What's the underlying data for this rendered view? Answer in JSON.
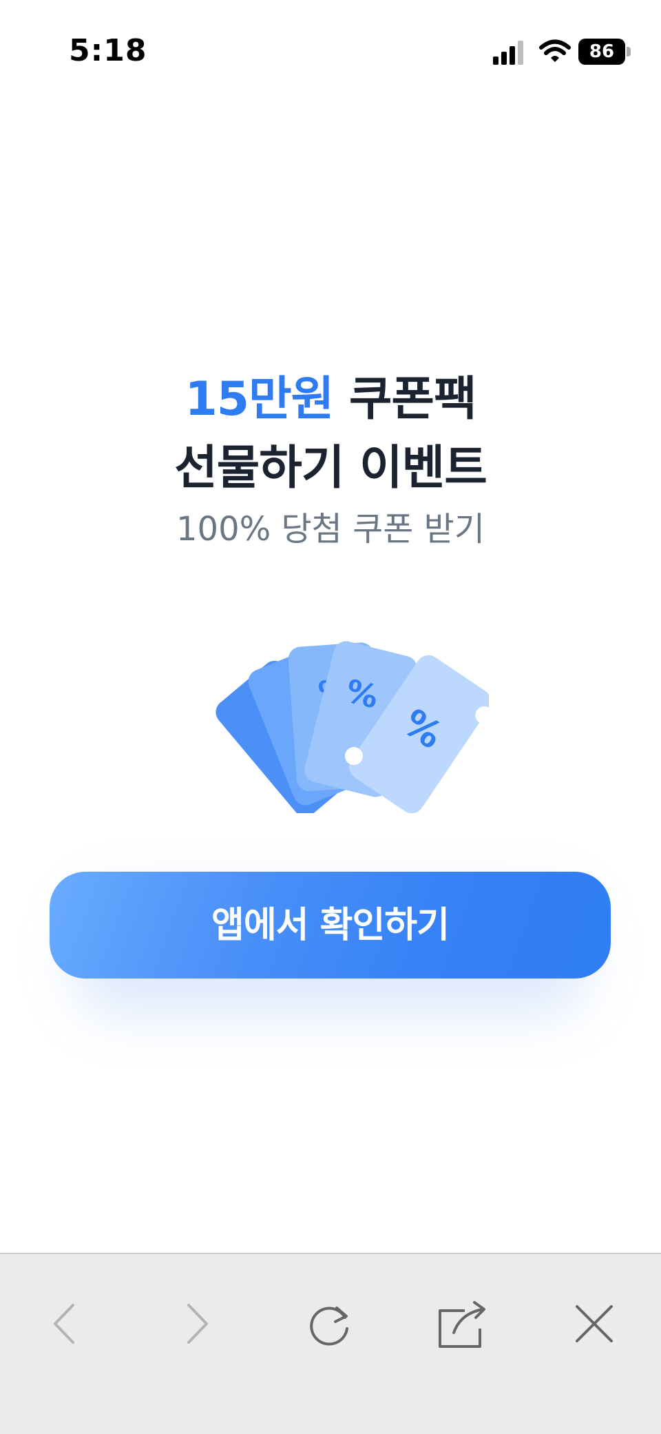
{
  "status_bar": {
    "time": "5:18",
    "battery": "86",
    "icons": [
      "cellular-signal-icon",
      "wifi-icon",
      "battery-icon"
    ]
  },
  "headline": {
    "line1_accent": "15만원",
    "line1_rest": " 쿠폰팩",
    "line2": "선물하기 이벤트"
  },
  "subtitle": "100% 당첨 쿠폰 받기",
  "illustration": {
    "icon": "coupon-tickets-icon",
    "symbol": "%"
  },
  "cta": {
    "label": "앱에서 확인하기"
  },
  "toolbar": {
    "icons": [
      "back-arrow-icon",
      "forward-arrow-icon",
      "reload-icon",
      "share-icon",
      "close-icon"
    ]
  },
  "colors": {
    "accent": "#2f7bf2",
    "text_dark": "#1b2230",
    "text_muted": "#6b7684",
    "button": "#3581f5",
    "toolbar_bg": "#ebebeb"
  }
}
